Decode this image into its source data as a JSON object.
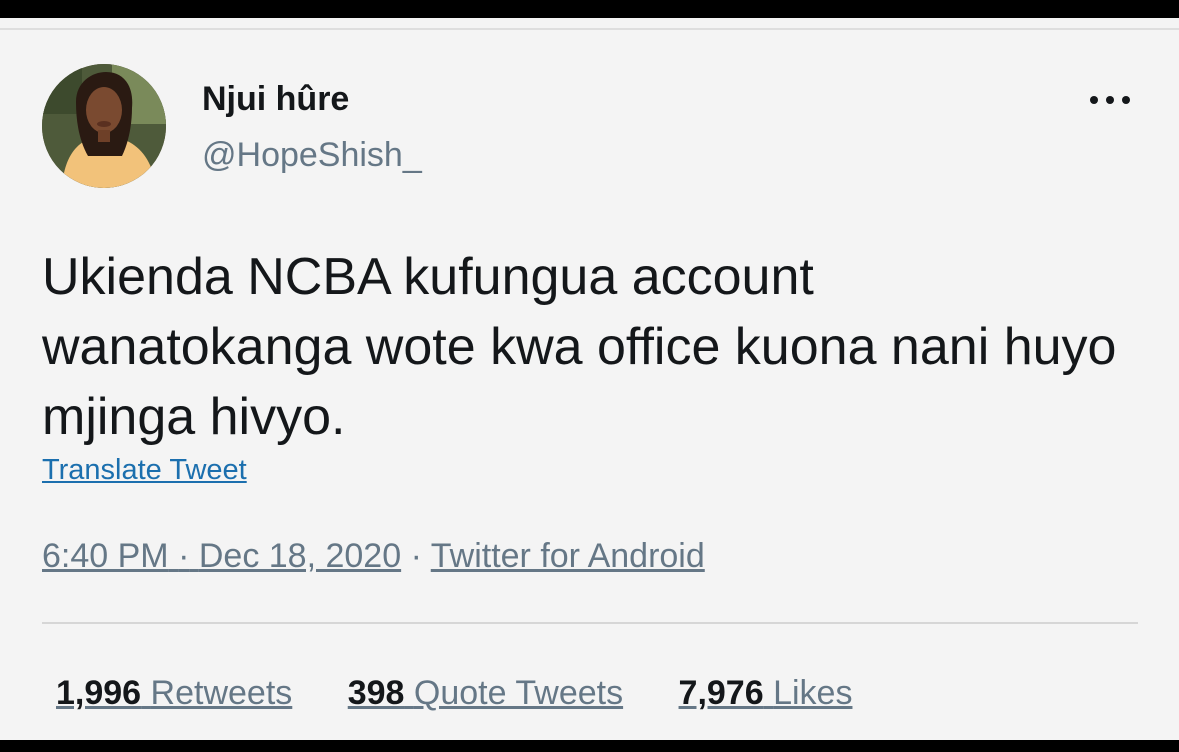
{
  "author": {
    "display_name": "Njui hûre",
    "handle": "@HopeShish_"
  },
  "tweet": {
    "text": "Ukienda NCBA kufungua account wanatokanga wote kwa office kuona nani huyo mjinga hivyo.",
    "translate_label": "Translate Tweet",
    "time": "6:40 PM",
    "date": "Dec 18, 2020",
    "source": "Twitter for Android",
    "separator": "·"
  },
  "stats": {
    "retweets": {
      "count": "1,996",
      "label": "Retweets"
    },
    "quote_tweets": {
      "count": "398",
      "label": "Quote Tweets"
    },
    "likes": {
      "count": "7,976",
      "label": "Likes"
    }
  },
  "icons": {
    "more": "more-horizontal-icon",
    "avatar": "profile-photo"
  },
  "colors": {
    "background": "#f4f4f4",
    "text": "#14171a",
    "muted": "#657786",
    "link": "#1b6fae",
    "frame": "#000000"
  }
}
